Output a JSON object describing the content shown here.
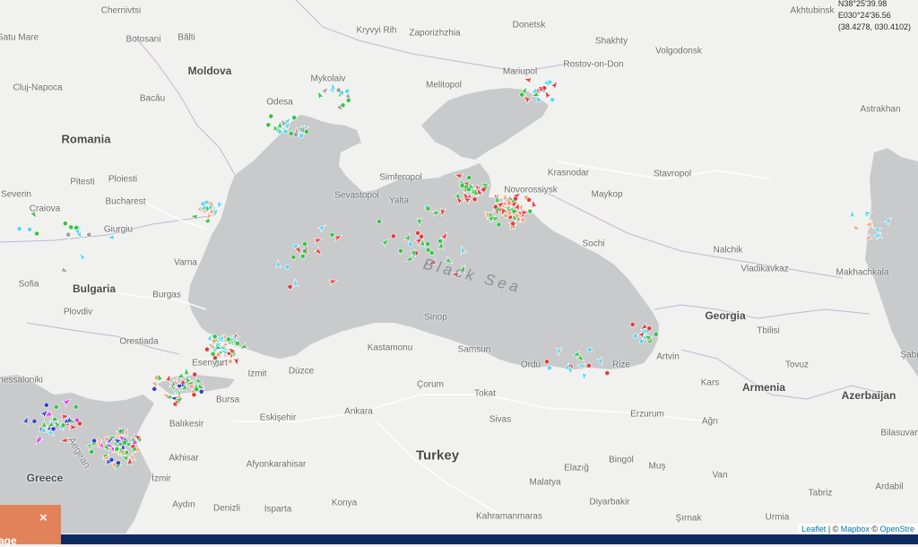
{
  "colors": {
    "land": "#f1f1ef",
    "sea": "#c9cacc",
    "border": "#b9a7c9",
    "road": "#ffffff",
    "cargo": "#39c24a",
    "tanker": "#e53b3b",
    "passenger": "#2f46c9",
    "fishing": "#f2a988",
    "other": "#5fd7ec",
    "special": "#e23be2",
    "idle": "#a0a0a0",
    "bottom_bar": "#0e2a63",
    "close_tab": "#e2825a"
  },
  "coordinates": {
    "lat_dms": "N38°25'39.98",
    "lon_dms": "E030°24'36.56",
    "decimal": "(38.4278, 030.4102)"
  },
  "sea_label": "Black Sea",
  "countries": [
    "Romania",
    "Moldova",
    "Bulgaria",
    "Georgia",
    "Armenia",
    "Azerbaijan",
    "Turkey",
    "Greece"
  ],
  "cities": [
    "Chernivtsi",
    "Satu Mare",
    "Botosani",
    "Bălti",
    "Kryvyi Rih",
    "Zaporizhzhia",
    "Donetsk",
    "Shakhty",
    "Volgodonsk",
    "Mykolaiv",
    "Melitopol",
    "Mariupol",
    "Rostov-on-Don",
    "Astrakhan",
    "Cluj-Napoca",
    "Bacău",
    "Odesa",
    "Simferopol",
    "Sevastopol",
    "Yalta",
    "Krasnodar",
    "Novorossiysk",
    "Maykop",
    "Stavropol",
    "Pitesti",
    "Ploiesti",
    "Bucharest",
    "Craiova",
    "Giurgiu",
    "Severin",
    "Sochi",
    "Nalchik",
    "Vladikavkaz",
    "Makhachkala",
    "Sofia",
    "Varna",
    "Burgas",
    "Plovdiv",
    "Orestiada",
    "Sinop",
    "Kastamonu",
    "Samsun",
    "Ordu",
    "Rize",
    "Artvin",
    "Tbilisi",
    "Kars",
    "Tovuz",
    "Thessaloniki",
    "Esenyurt",
    "Izmit",
    "Düzce",
    "Bursa",
    "Balıkesir",
    "Eskişehir",
    "Ankara",
    "Çorum",
    "Tokat",
    "Sivas",
    "Erzurum",
    "Ağrı",
    "Akhisar",
    "İzmir",
    "Afyonkarahisar",
    "Elazığ",
    "Bingöl",
    "Muş",
    "Van",
    "Malatya",
    "Diyarbakir",
    "Tabriz",
    "Ardabil",
    "Konya",
    "Kahramanmaras",
    "Şırnak",
    "Urmia",
    "Aydın",
    "Denizli",
    "Isparta",
    "Bilasuvar",
    "Şabr",
    "Akhtubinsk",
    "Aegean"
  ],
  "attribution": {
    "leaflet": "Leaflet",
    "sep1": " | © ",
    "mapbox": "Mapbox",
    "sep2": " © ",
    "osm": "OpenStre"
  },
  "close_tab": {
    "close_symbol": "×",
    "label": "age"
  }
}
